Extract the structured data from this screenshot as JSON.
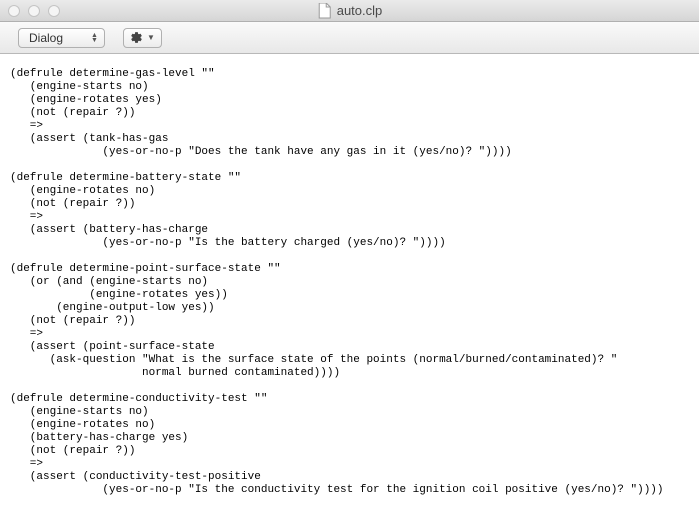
{
  "window": {
    "title": "auto.clp"
  },
  "toolbar": {
    "dropdown_label": "Dialog",
    "gear_label": ""
  },
  "editor": {
    "content": "(defrule determine-gas-level \"\"\n   (engine-starts no)\n   (engine-rotates yes)\n   (not (repair ?))\n   =>\n   (assert (tank-has-gas\n              (yes-or-no-p \"Does the tank have any gas in it (yes/no)? \"))))\n\n(defrule determine-battery-state \"\"\n   (engine-rotates no)\n   (not (repair ?))\n   =>\n   (assert (battery-has-charge\n              (yes-or-no-p \"Is the battery charged (yes/no)? \"))))\n\n(defrule determine-point-surface-state \"\"\n   (or (and (engine-starts no)\n            (engine-rotates yes))\n       (engine-output-low yes))\n   (not (repair ?))\n   =>\n   (assert (point-surface-state\n      (ask-question \"What is the surface state of the points (normal/burned/contaminated)? \"\n                    normal burned contaminated))))\n\n(defrule determine-conductivity-test \"\"\n   (engine-starts no)\n   (engine-rotates no)\n   (battery-has-charge yes)\n   (not (repair ?))\n   =>\n   (assert (conductivity-test-positive\n              (yes-or-no-p \"Is the conductivity test for the ignition coil positive (yes/no)? \"))))"
  }
}
